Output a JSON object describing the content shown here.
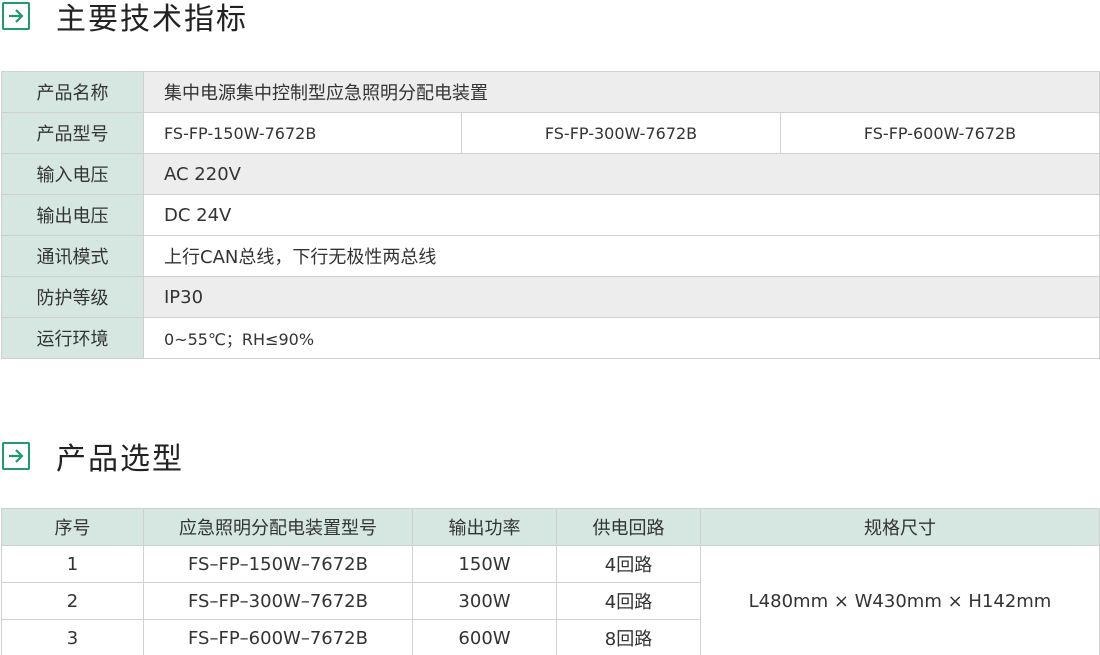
{
  "section1": {
    "title": "主要技术指标",
    "icon": "arrow-right-icon",
    "accent": "#1f9a6b"
  },
  "spec": {
    "name": {
      "label": "产品名称",
      "value": "集中电源集中控制型应急照明分配电装置"
    },
    "model": {
      "label": "产品型号",
      "values": [
        "FS-FP-150W-7672B",
        "FS-FP-300W-7672B",
        "FS-FP-600W-7672B"
      ]
    },
    "input_voltage": {
      "label": "输入电压",
      "value": "AC 220V"
    },
    "output_voltage": {
      "label": "输出电压",
      "value": "DC 24V"
    },
    "comm": {
      "label": "通讯模式",
      "value": "上行CAN总线，下行无极性两总线"
    },
    "protection": {
      "label": "防护等级",
      "value": "IP30"
    },
    "environment": {
      "label": "运行环境",
      "value": "0~55℃；RH≤90%"
    }
  },
  "section2": {
    "title": "产品选型",
    "icon": "arrow-right-icon"
  },
  "selection": {
    "headers": [
      "序号",
      "应急照明分配电装置型号",
      "输出功率",
      "供电回路",
      "规格尺寸"
    ],
    "rows": [
      {
        "no": "1",
        "model": "FS–FP–150W–7672B",
        "power": "150W",
        "circuits": "4回路"
      },
      {
        "no": "2",
        "model": "FS–FP–300W–7672B",
        "power": "300W",
        "circuits": "4回路"
      },
      {
        "no": "3",
        "model": "FS–FP–600W–7672B",
        "power": "600W",
        "circuits": "8回路"
      }
    ],
    "size": "L480mm × W430mm × H142mm"
  },
  "colors": {
    "header_bg": "#d6e7e2",
    "shade_bg": "#ededed",
    "border": "#d0d0d0"
  }
}
